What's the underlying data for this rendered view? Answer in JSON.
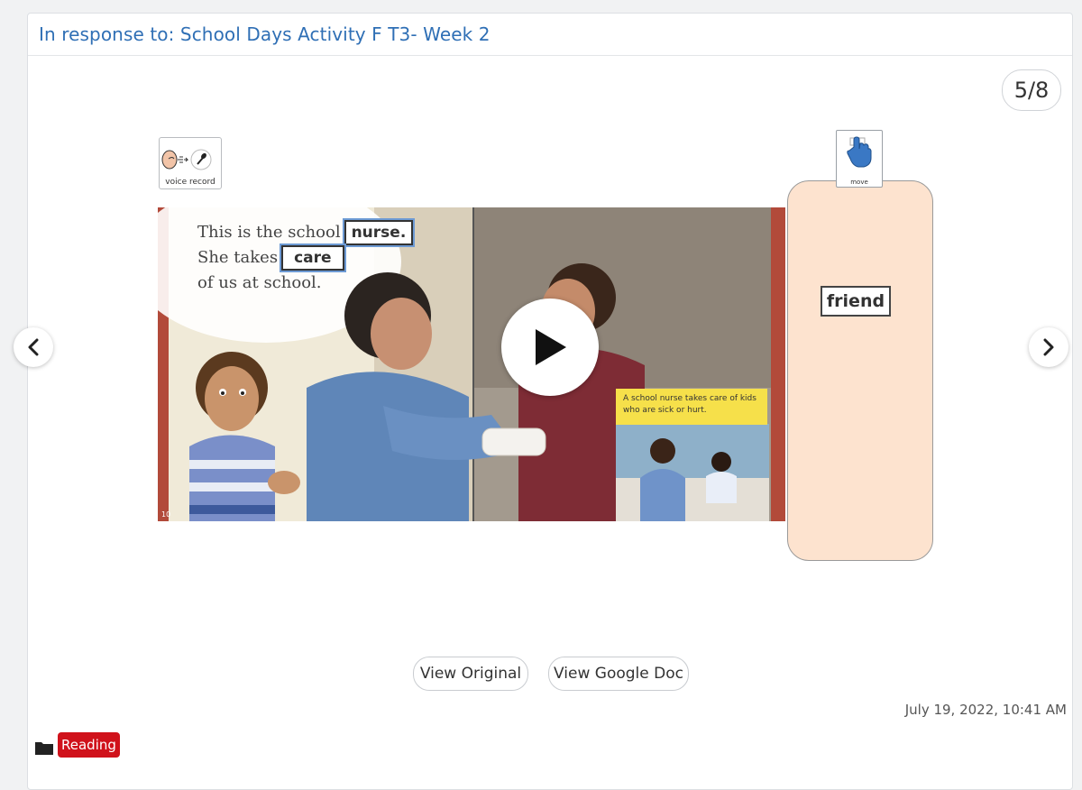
{
  "header": {
    "title": "In response to: School Days Activity F T3- Week 2"
  },
  "pager": {
    "current": 5,
    "total": 8,
    "label": "5/8"
  },
  "voice_card": {
    "label": "voice record"
  },
  "move_card": {
    "label": "move"
  },
  "drop_zone": {
    "word": "friend"
  },
  "story": {
    "line1": "This is the school",
    "word1": "nurse.",
    "line2": "She takes",
    "word2": "care",
    "line3": "of us at school.",
    "caption": "A school nurse takes care of kids who are sick or hurt."
  },
  "actions": {
    "view_original": "View Original",
    "view_google_doc": "View Google Doc"
  },
  "timestamp": "July 19, 2022, 10:41 AM",
  "tag": {
    "label": "Reading",
    "color": "#d0121b"
  },
  "colors": {
    "accent": "#2f6fb5",
    "drop_zone": "#fde3cf",
    "caption_bg": "#f6e04a"
  },
  "icons": {
    "left": "chevron-left-icon",
    "right": "chevron-right-icon",
    "play": "play-icon",
    "folder": "folder-icon",
    "voice": "voice-record-icon",
    "move": "move-hand-icon"
  }
}
